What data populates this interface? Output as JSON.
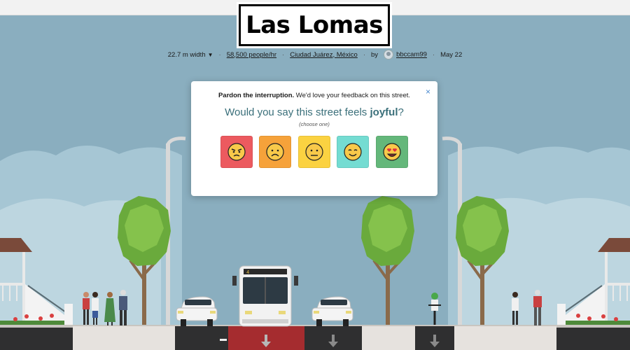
{
  "street": {
    "name": "Las Lomas",
    "width": "22.7 m width",
    "capacity": "58,500 people/hr",
    "location": "Ciudad Juárez, México",
    "by_label": "by",
    "author": "bbccam99",
    "date": "May 22"
  },
  "icons": {
    "width_caret": "caret-down-icon",
    "avatar": "user-avatar-icon",
    "close": "close-icon",
    "lane_arrow": "down-arrow-icon"
  },
  "bus": {
    "route_number": "4"
  },
  "feedback": {
    "intro_bold": "Pardon the interruption.",
    "intro_rest": " We'd love your feedback on this street.",
    "question_prefix": "Would you say this street feels ",
    "question_word": "joyful",
    "question_suffix": "?",
    "hint": "(choose one)",
    "close_symbol": "×",
    "options": [
      {
        "name": "angry-face-icon",
        "color": "#ec5a5f"
      },
      {
        "name": "sad-face-icon",
        "color": "#f6a23a"
      },
      {
        "name": "neutral-face-icon",
        "color": "#fbd241"
      },
      {
        "name": "smiling-face-icon",
        "color": "#74dcd2"
      },
      {
        "name": "heart-eyes-face-icon",
        "color": "#64b77a"
      }
    ]
  },
  "colors": {
    "sky": "#8aaebf",
    "sidewalk": "#e6e2de",
    "asphalt": "#2f2f30",
    "bus_lane": "#a52c2f",
    "tree_foliage": "#6aaa3c",
    "ground": "#3a3a3a"
  }
}
